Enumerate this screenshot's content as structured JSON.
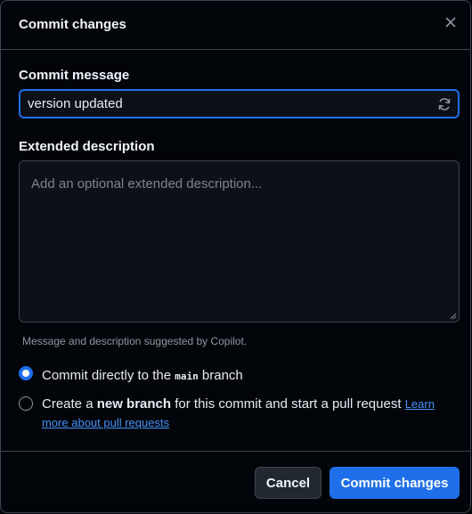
{
  "dialog": {
    "title": "Commit changes",
    "close_icon": "x-icon"
  },
  "commit_message": {
    "label": "Commit message",
    "value": "version updated",
    "regenerate_icon": "refresh-icon"
  },
  "extended_description": {
    "label": "Extended description",
    "placeholder": "Add an optional extended description..."
  },
  "hint": "Message and description suggested by Copilot.",
  "options": {
    "direct": {
      "checked": true,
      "prefix": "Commit directly to the ",
      "branch": "main",
      "suffix": " branch"
    },
    "new_branch": {
      "checked": false,
      "prefix": "Create a ",
      "bold": "new branch",
      "suffix": " for this commit and start a pull request ",
      "link": "Learn more about pull requests"
    }
  },
  "footer": {
    "cancel_label": "Cancel",
    "commit_label": "Commit changes"
  },
  "colors": {
    "accent": "#1f6feb",
    "background": "#010409",
    "border": "#3d444d",
    "link": "#4493f8"
  }
}
